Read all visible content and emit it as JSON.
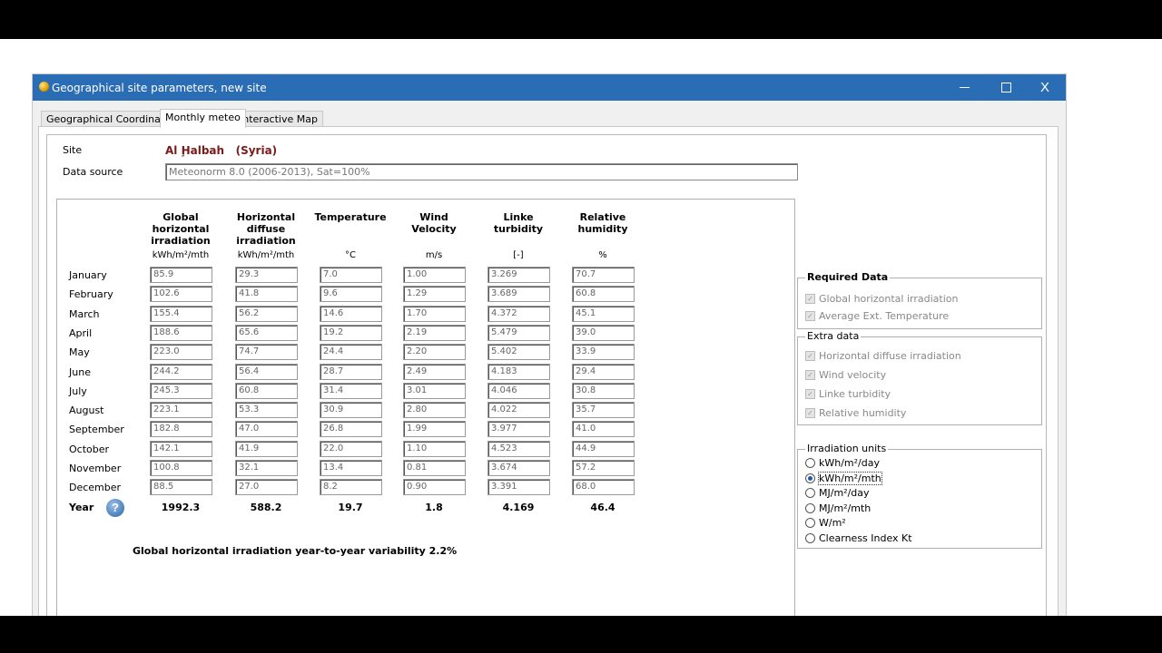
{
  "window": {
    "title": "Geographical site parameters, new site",
    "min_glyph": "",
    "max_glyph": "",
    "close_glyph": "X"
  },
  "tabs": [
    "Geographical Coordinates",
    "Monthly meteo",
    "Interactive Map"
  ],
  "site": {
    "label": "Site",
    "name": "Al Ḩalbah   (Syria)"
  },
  "data_source": {
    "label": "Data source",
    "value": "Meteonorm 8.0 (2006-2013), Sat=100%"
  },
  "columns": [
    {
      "header": "Global horizontal irradiation",
      "unit": "kWh/m²/mth"
    },
    {
      "header": "Horizontal diffuse irradiation",
      "unit": "kWh/m²/mth"
    },
    {
      "header": "Temperature",
      "unit": "°C"
    },
    {
      "header": "Wind Velocity",
      "unit": "m/s"
    },
    {
      "header": "Linke turbidity",
      "unit": "[-]"
    },
    {
      "header": "Relative humidity",
      "unit": "%"
    }
  ],
  "rows": [
    {
      "month": "January",
      "values": [
        "85.9",
        "29.3",
        "7.0",
        "1.00",
        "3.269",
        "70.7"
      ]
    },
    {
      "month": "February",
      "values": [
        "102.6",
        "41.8",
        "9.6",
        "1.29",
        "3.689",
        "60.8"
      ]
    },
    {
      "month": "March",
      "values": [
        "155.4",
        "56.2",
        "14.6",
        "1.70",
        "4.372",
        "45.1"
      ]
    },
    {
      "month": "April",
      "values": [
        "188.6",
        "65.6",
        "19.2",
        "2.19",
        "5.479",
        "39.0"
      ]
    },
    {
      "month": "May",
      "values": [
        "223.0",
        "74.7",
        "24.4",
        "2.20",
        "5.402",
        "33.9"
      ]
    },
    {
      "month": "June",
      "values": [
        "244.2",
        "56.4",
        "28.7",
        "2.49",
        "4.183",
        "29.4"
      ]
    },
    {
      "month": "July",
      "values": [
        "245.3",
        "60.8",
        "31.4",
        "3.01",
        "4.046",
        "30.8"
      ]
    },
    {
      "month": "August",
      "values": [
        "223.1",
        "53.3",
        "30.9",
        "2.80",
        "4.022",
        "35.7"
      ]
    },
    {
      "month": "September",
      "values": [
        "182.8",
        "47.0",
        "26.8",
        "1.99",
        "3.977",
        "41.0"
      ]
    },
    {
      "month": "October",
      "values": [
        "142.1",
        "41.9",
        "22.0",
        "1.10",
        "4.523",
        "44.9"
      ]
    },
    {
      "month": "November",
      "values": [
        "100.8",
        "32.1",
        "13.4",
        "0.81",
        "3.674",
        "57.2"
      ]
    },
    {
      "month": "December",
      "values": [
        "88.5",
        "27.0",
        "8.2",
        "0.90",
        "3.391",
        "68.0"
      ]
    }
  ],
  "year": {
    "label": "Year",
    "values": [
      "1992.3",
      "588.2",
      "19.7",
      "1.8",
      "4.169",
      "46.4"
    ]
  },
  "help_glyph": "?",
  "variability": "Global horizontal irradiation year-to-year variability  2.2%",
  "required_data": {
    "title": "Required Data",
    "items": [
      "Global horizontal irradiation",
      "Average Ext. Temperature"
    ]
  },
  "extra_data": {
    "title": "Extra data",
    "items": [
      "Horizontal diffuse irradiation",
      "Wind velocity",
      "Linke turbidity",
      "Relative humidity"
    ]
  },
  "irradiation_units": {
    "title": "Irradiation units",
    "options": [
      "kWh/m²/day",
      "kWh/m²/mth",
      "MJ/m²/day",
      "MJ/m²/mth",
      "W/m²",
      "Clearness Index Kt"
    ],
    "selected": "kWh/m²/mth"
  },
  "check_glyph": "✓"
}
